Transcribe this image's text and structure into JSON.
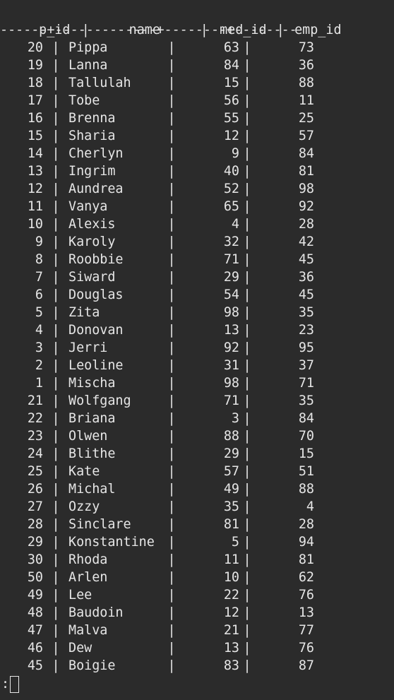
{
  "table": {
    "headers": {
      "p_id": "p_id",
      "name": "name",
      "med_id": "med_id",
      "emp_id": "emp_id"
    },
    "separator": "------+-------------+--------+--------",
    "rows": [
      {
        "p_id": "20",
        "name": "Pippa",
        "med_id": "63",
        "emp_id": "73"
      },
      {
        "p_id": "19",
        "name": "Lanna",
        "med_id": "84",
        "emp_id": "36"
      },
      {
        "p_id": "18",
        "name": "Tallulah",
        "med_id": "15",
        "emp_id": "88"
      },
      {
        "p_id": "17",
        "name": "Tobe",
        "med_id": "56",
        "emp_id": "11"
      },
      {
        "p_id": "16",
        "name": "Brenna",
        "med_id": "55",
        "emp_id": "25"
      },
      {
        "p_id": "15",
        "name": "Sharia",
        "med_id": "12",
        "emp_id": "57"
      },
      {
        "p_id": "14",
        "name": "Cherlyn",
        "med_id": "9",
        "emp_id": "84"
      },
      {
        "p_id": "13",
        "name": "Ingrim",
        "med_id": "40",
        "emp_id": "81"
      },
      {
        "p_id": "12",
        "name": "Aundrea",
        "med_id": "52",
        "emp_id": "98"
      },
      {
        "p_id": "11",
        "name": "Vanya",
        "med_id": "65",
        "emp_id": "92"
      },
      {
        "p_id": "10",
        "name": "Alexis",
        "med_id": "4",
        "emp_id": "28"
      },
      {
        "p_id": "9",
        "name": "Karoly",
        "med_id": "32",
        "emp_id": "42"
      },
      {
        "p_id": "8",
        "name": "Roobbie",
        "med_id": "71",
        "emp_id": "45"
      },
      {
        "p_id": "7",
        "name": "Siward",
        "med_id": "29",
        "emp_id": "36"
      },
      {
        "p_id": "6",
        "name": "Douglas",
        "med_id": "54",
        "emp_id": "45"
      },
      {
        "p_id": "5",
        "name": "Zita",
        "med_id": "98",
        "emp_id": "35"
      },
      {
        "p_id": "4",
        "name": "Donovan",
        "med_id": "13",
        "emp_id": "23"
      },
      {
        "p_id": "3",
        "name": "Jerri",
        "med_id": "92",
        "emp_id": "95"
      },
      {
        "p_id": "2",
        "name": "Leoline",
        "med_id": "31",
        "emp_id": "37"
      },
      {
        "p_id": "1",
        "name": "Mischa",
        "med_id": "98",
        "emp_id": "71"
      },
      {
        "p_id": "21",
        "name": "Wolfgang",
        "med_id": "71",
        "emp_id": "35"
      },
      {
        "p_id": "22",
        "name": "Briana",
        "med_id": "3",
        "emp_id": "84"
      },
      {
        "p_id": "23",
        "name": "Olwen",
        "med_id": "88",
        "emp_id": "70"
      },
      {
        "p_id": "24",
        "name": "Blithe",
        "med_id": "29",
        "emp_id": "15"
      },
      {
        "p_id": "25",
        "name": "Kate",
        "med_id": "57",
        "emp_id": "51"
      },
      {
        "p_id": "26",
        "name": "Michal",
        "med_id": "49",
        "emp_id": "88"
      },
      {
        "p_id": "27",
        "name": "Ozzy",
        "med_id": "35",
        "emp_id": "4"
      },
      {
        "p_id": "28",
        "name": "Sinclare",
        "med_id": "81",
        "emp_id": "28"
      },
      {
        "p_id": "29",
        "name": "Konstantine",
        "med_id": "5",
        "emp_id": "94"
      },
      {
        "p_id": "30",
        "name": "Rhoda",
        "med_id": "11",
        "emp_id": "81"
      },
      {
        "p_id": "50",
        "name": "Arlen",
        "med_id": "10",
        "emp_id": "62"
      },
      {
        "p_id": "49",
        "name": "Lee",
        "med_id": "22",
        "emp_id": "76"
      },
      {
        "p_id": "48",
        "name": "Baudoin",
        "med_id": "12",
        "emp_id": "13"
      },
      {
        "p_id": "47",
        "name": "Malva",
        "med_id": "21",
        "emp_id": "77"
      },
      {
        "p_id": "46",
        "name": "Dew",
        "med_id": "13",
        "emp_id": "76"
      },
      {
        "p_id": "45",
        "name": "Boigie",
        "med_id": "83",
        "emp_id": "87"
      }
    ]
  },
  "pager": {
    "prompt": ":"
  }
}
